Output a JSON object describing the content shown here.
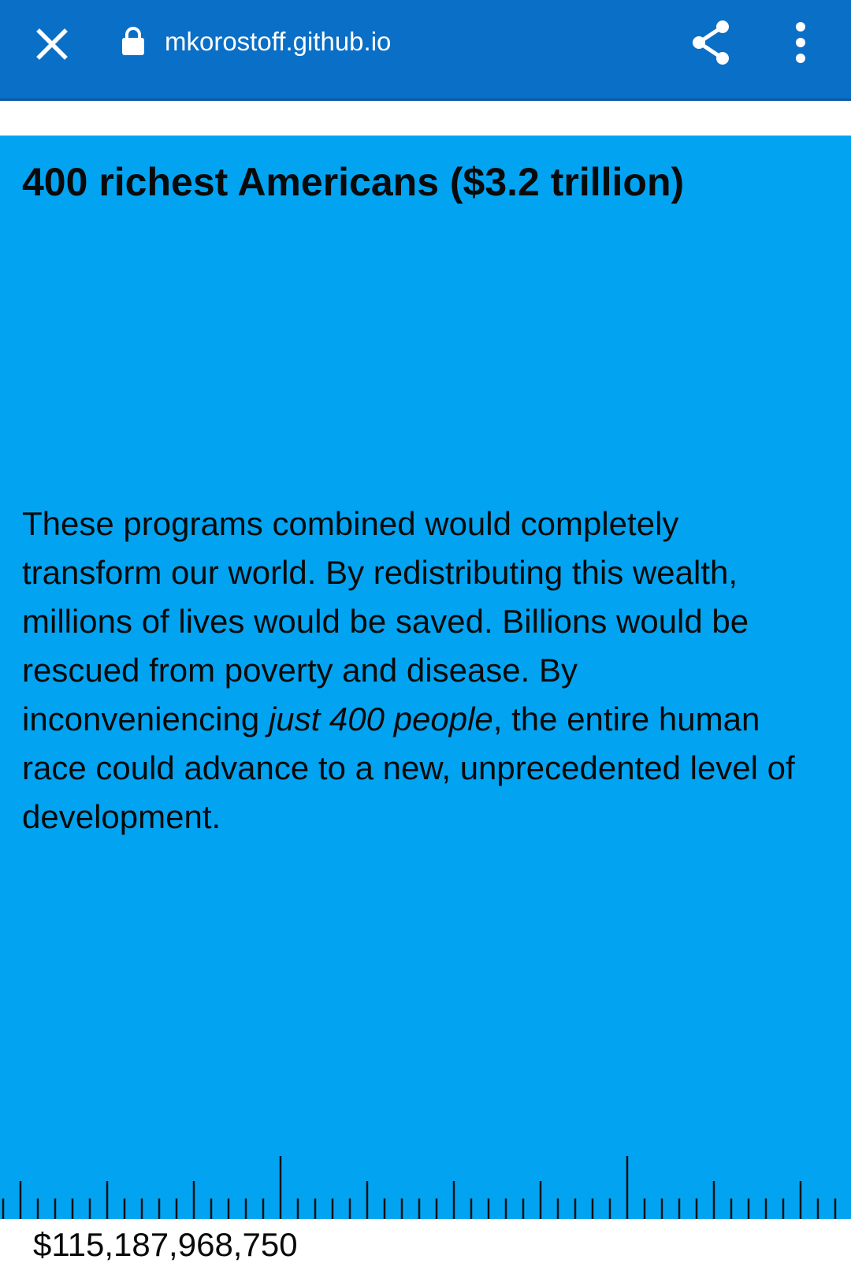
{
  "browser": {
    "url": "mkorostoff.github.io",
    "close_icon": "close-icon",
    "lock_icon": "lock-icon",
    "share_icon": "share-icon",
    "menu_icon": "more-vertical-icon",
    "toolbar_color": "#0a6fc6"
  },
  "page": {
    "background_color": "#02a4f2",
    "title": "400 richest Americans ($3.2 trillion)",
    "paragraph_part1": "These programs combined would completely transform our world. By redistributing this wealth, millions of lives would be saved. Billions would be rescued from poverty and disease. By inconveniencing ",
    "paragraph_emphasis": "just 400 people",
    "paragraph_part2": ", the entire human race could advance to a new, unprecedented level of development.",
    "counter_value": "$115,187,968,750"
  }
}
